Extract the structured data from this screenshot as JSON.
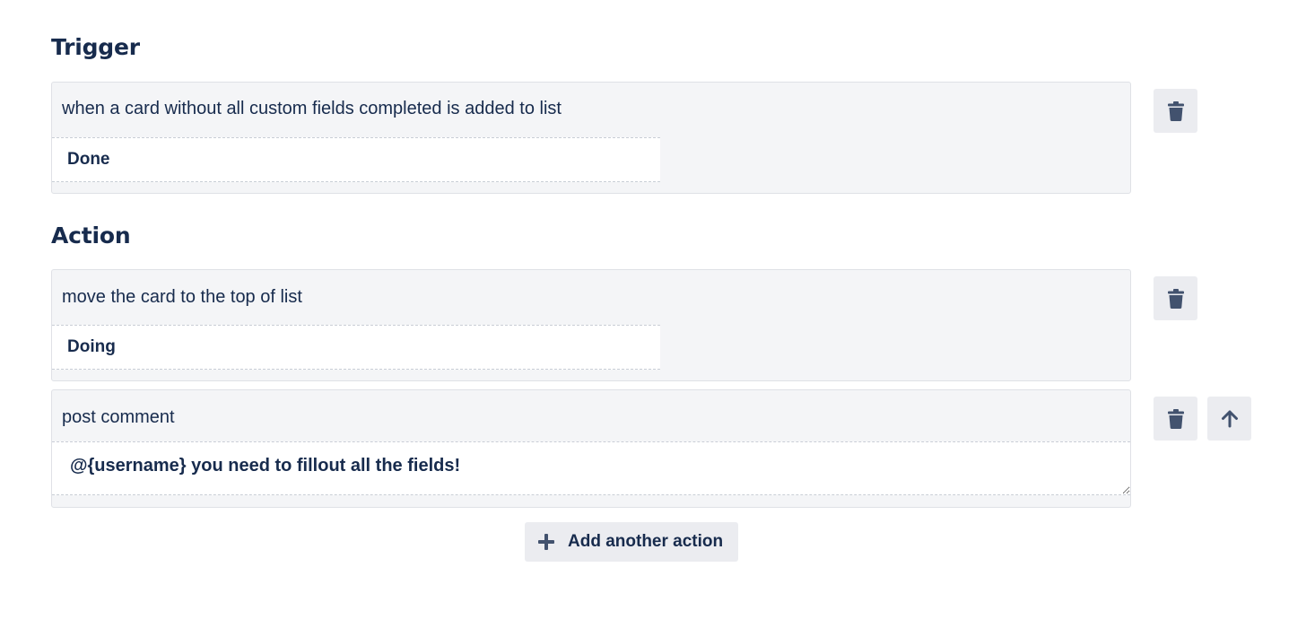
{
  "trigger": {
    "heading": "Trigger",
    "description": "when a card without all custom fields completed is added to list",
    "list_value": "Done"
  },
  "action": {
    "heading": "Action",
    "items": [
      {
        "description": "move the card to the top of list",
        "list_value": "Doing"
      },
      {
        "description": "post comment",
        "comment_value": "@{username} you need to fillout all the fields!"
      }
    ],
    "add_label": "Add another action"
  },
  "icons": {
    "delete": "trash-icon",
    "move_up": "arrow-up-icon",
    "add": "plus-icon"
  },
  "colors": {
    "text": "#172b4d",
    "icon": "#42526e",
    "box_bg": "#f4f5f7",
    "button_bg": "#ebecf0",
    "border": "#dfe1e6"
  }
}
